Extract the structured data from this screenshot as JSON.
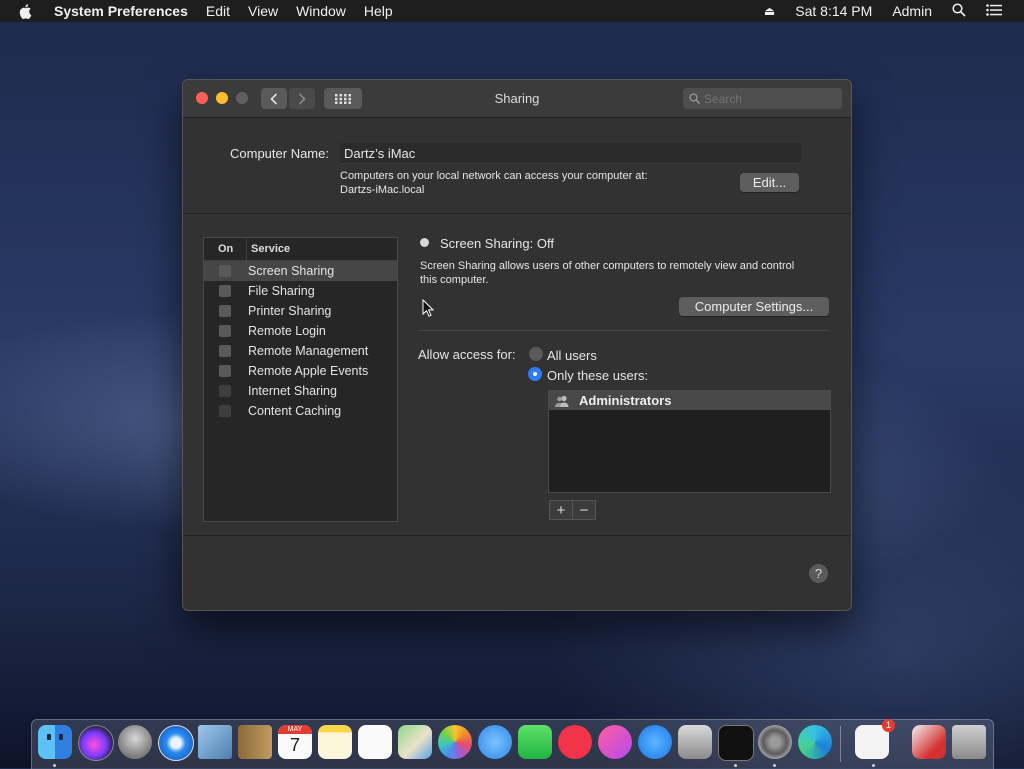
{
  "menubar": {
    "app_name": "System Preferences",
    "menus": [
      "Edit",
      "View",
      "Window",
      "Help"
    ],
    "clock": "Sat 8:14 PM",
    "user": "Admin"
  },
  "window": {
    "title": "Sharing",
    "search_placeholder": "Search",
    "computer_name_label": "Computer Name:",
    "computer_name_value": "Dartz’s iMac",
    "network_info_line1": "Computers on your local network can access your computer at:",
    "network_info_line2": "Dartzs-iMac.local",
    "edit_button": "Edit..."
  },
  "services": {
    "header_on": "On",
    "header_service": "Service",
    "items": [
      {
        "label": "Screen Sharing",
        "checked": false,
        "selected": true
      },
      {
        "label": "File Sharing",
        "checked": false
      },
      {
        "label": "Printer Sharing",
        "checked": false
      },
      {
        "label": "Remote Login",
        "checked": false
      },
      {
        "label": "Remote Management",
        "checked": false
      },
      {
        "label": "Remote Apple Events",
        "checked": false
      },
      {
        "label": "Internet Sharing",
        "checked": false
      },
      {
        "label": "Content Caching",
        "checked": false
      }
    ]
  },
  "detail": {
    "status_title": "Screen Sharing: Off",
    "description_line1": "Screen Sharing allows users of other computers to remotely view and control",
    "description_line2": "this computer.",
    "computer_settings_button": "Computer Settings...",
    "allow_access_label": "Allow access for:",
    "option_all_users": "All users",
    "option_only_these": "Only these users:",
    "selected_option": "Only these users:",
    "users": [
      "Administrators"
    ],
    "add_label": "+",
    "remove_label": "−",
    "help_label": "?"
  },
  "dock": {
    "apps": [
      "Finder",
      "Siri",
      "Launchpad",
      "Safari",
      "Mail",
      "Contacts",
      "Calendar",
      "Notes",
      "Reminders",
      "Maps",
      "Photos",
      "Messages",
      "FaceTime",
      "News",
      "iTunes",
      "App Store",
      "Disk Utility",
      "Terminal",
      "System Preferences",
      "Microsoft Edge",
      "Microsoft Remote Desktop",
      "Acrobat",
      "Trash"
    ],
    "calendar_month": "MAY",
    "calendar_day": "7",
    "badge_count": "1"
  },
  "colors": {
    "accent_blue": "#2d7cf6",
    "close": "#fe5f57",
    "minimize": "#febc2e",
    "disabled": "#5f5f5f"
  }
}
